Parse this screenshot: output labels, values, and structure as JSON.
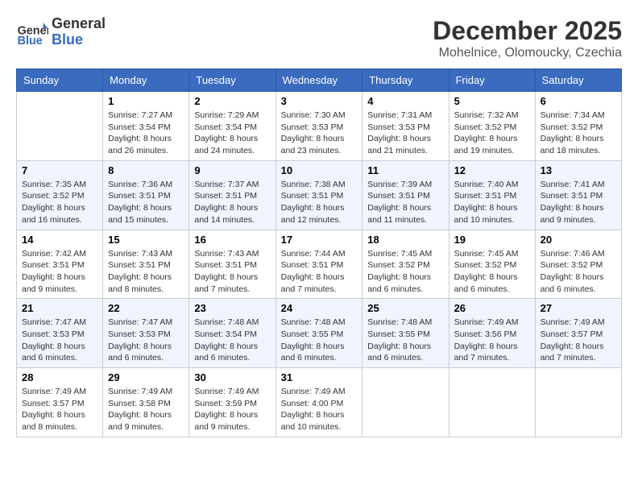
{
  "header": {
    "logo_line1": "General",
    "logo_line2": "Blue",
    "title": "December 2025",
    "subtitle": "Mohelnice, Olomoucky, Czechia"
  },
  "days_of_week": [
    "Sunday",
    "Monday",
    "Tuesday",
    "Wednesday",
    "Thursday",
    "Friday",
    "Saturday"
  ],
  "weeks": [
    [
      {
        "day": "",
        "info": ""
      },
      {
        "day": "1",
        "info": "Sunrise: 7:27 AM\nSunset: 3:54 PM\nDaylight: 8 hours and 26 minutes."
      },
      {
        "day": "2",
        "info": "Sunrise: 7:29 AM\nSunset: 3:54 PM\nDaylight: 8 hours and 24 minutes."
      },
      {
        "day": "3",
        "info": "Sunrise: 7:30 AM\nSunset: 3:53 PM\nDaylight: 8 hours and 23 minutes."
      },
      {
        "day": "4",
        "info": "Sunrise: 7:31 AM\nSunset: 3:53 PM\nDaylight: 8 hours and 21 minutes."
      },
      {
        "day": "5",
        "info": "Sunrise: 7:32 AM\nSunset: 3:52 PM\nDaylight: 8 hours and 19 minutes."
      },
      {
        "day": "6",
        "info": "Sunrise: 7:34 AM\nSunset: 3:52 PM\nDaylight: 8 hours and 18 minutes."
      }
    ],
    [
      {
        "day": "7",
        "info": "Sunrise: 7:35 AM\nSunset: 3:52 PM\nDaylight: 8 hours and 16 minutes."
      },
      {
        "day": "8",
        "info": "Sunrise: 7:36 AM\nSunset: 3:51 PM\nDaylight: 8 hours and 15 minutes."
      },
      {
        "day": "9",
        "info": "Sunrise: 7:37 AM\nSunset: 3:51 PM\nDaylight: 8 hours and 14 minutes."
      },
      {
        "day": "10",
        "info": "Sunrise: 7:38 AM\nSunset: 3:51 PM\nDaylight: 8 hours and 12 minutes."
      },
      {
        "day": "11",
        "info": "Sunrise: 7:39 AM\nSunset: 3:51 PM\nDaylight: 8 hours and 11 minutes."
      },
      {
        "day": "12",
        "info": "Sunrise: 7:40 AM\nSunset: 3:51 PM\nDaylight: 8 hours and 10 minutes."
      },
      {
        "day": "13",
        "info": "Sunrise: 7:41 AM\nSunset: 3:51 PM\nDaylight: 8 hours and 9 minutes."
      }
    ],
    [
      {
        "day": "14",
        "info": "Sunrise: 7:42 AM\nSunset: 3:51 PM\nDaylight: 8 hours and 9 minutes."
      },
      {
        "day": "15",
        "info": "Sunrise: 7:43 AM\nSunset: 3:51 PM\nDaylight: 8 hours and 8 minutes."
      },
      {
        "day": "16",
        "info": "Sunrise: 7:43 AM\nSunset: 3:51 PM\nDaylight: 8 hours and 7 minutes."
      },
      {
        "day": "17",
        "info": "Sunrise: 7:44 AM\nSunset: 3:51 PM\nDaylight: 8 hours and 7 minutes."
      },
      {
        "day": "18",
        "info": "Sunrise: 7:45 AM\nSunset: 3:52 PM\nDaylight: 8 hours and 6 minutes."
      },
      {
        "day": "19",
        "info": "Sunrise: 7:45 AM\nSunset: 3:52 PM\nDaylight: 8 hours and 6 minutes."
      },
      {
        "day": "20",
        "info": "Sunrise: 7:46 AM\nSunset: 3:52 PM\nDaylight: 8 hours and 6 minutes."
      }
    ],
    [
      {
        "day": "21",
        "info": "Sunrise: 7:47 AM\nSunset: 3:53 PM\nDaylight: 8 hours and 6 minutes."
      },
      {
        "day": "22",
        "info": "Sunrise: 7:47 AM\nSunset: 3:53 PM\nDaylight: 8 hours and 6 minutes."
      },
      {
        "day": "23",
        "info": "Sunrise: 7:48 AM\nSunset: 3:54 PM\nDaylight: 8 hours and 6 minutes."
      },
      {
        "day": "24",
        "info": "Sunrise: 7:48 AM\nSunset: 3:55 PM\nDaylight: 8 hours and 6 minutes."
      },
      {
        "day": "25",
        "info": "Sunrise: 7:48 AM\nSunset: 3:55 PM\nDaylight: 8 hours and 6 minutes."
      },
      {
        "day": "26",
        "info": "Sunrise: 7:49 AM\nSunset: 3:56 PM\nDaylight: 8 hours and 7 minutes."
      },
      {
        "day": "27",
        "info": "Sunrise: 7:49 AM\nSunset: 3:57 PM\nDaylight: 8 hours and 7 minutes."
      }
    ],
    [
      {
        "day": "28",
        "info": "Sunrise: 7:49 AM\nSunset: 3:57 PM\nDaylight: 8 hours and 8 minutes."
      },
      {
        "day": "29",
        "info": "Sunrise: 7:49 AM\nSunset: 3:58 PM\nDaylight: 8 hours and 9 minutes."
      },
      {
        "day": "30",
        "info": "Sunrise: 7:49 AM\nSunset: 3:59 PM\nDaylight: 8 hours and 9 minutes."
      },
      {
        "day": "31",
        "info": "Sunrise: 7:49 AM\nSunset: 4:00 PM\nDaylight: 8 hours and 10 minutes."
      },
      {
        "day": "",
        "info": ""
      },
      {
        "day": "",
        "info": ""
      },
      {
        "day": "",
        "info": ""
      }
    ]
  ]
}
